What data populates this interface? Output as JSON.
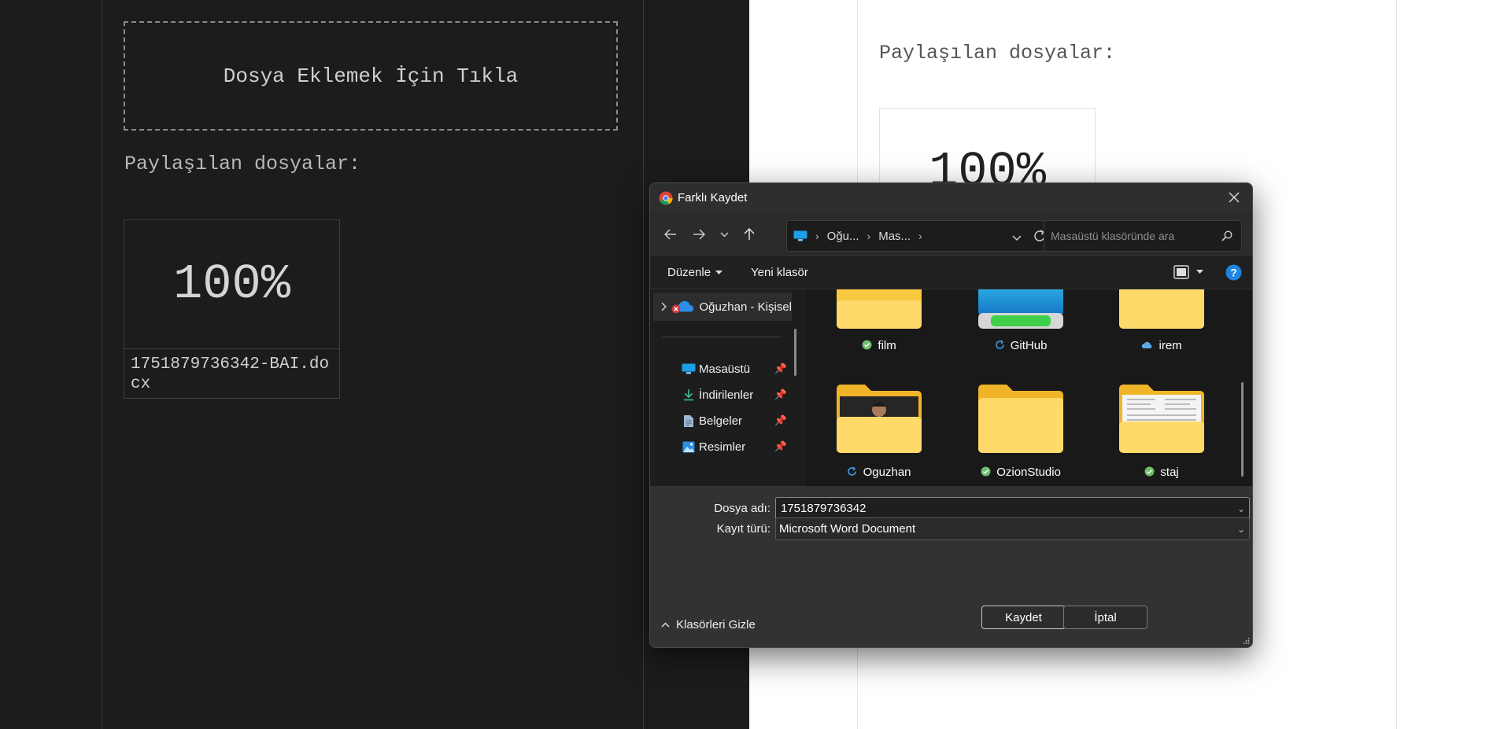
{
  "background_page": {
    "dropzone_text": "Dosya Eklemek İçin Tıkla",
    "shared_label": "Paylaşılan dosyalar:",
    "file_card": {
      "percent": "100%",
      "file_name": "1751879736342-BAI.docx"
    }
  },
  "light_page": {
    "shared_label": "Paylaşılan dosyalar:",
    "file_card": {
      "percent": "100%"
    }
  },
  "dialog": {
    "title": "Farklı Kaydet",
    "breadcrumb": [
      "Oğu...",
      "Mas..."
    ],
    "search_placeholder": "Masaüstü klasöründe ara",
    "toolbar": {
      "organize_label": "Düzenle",
      "new_folder_label": "Yeni klasör"
    },
    "nav_items": [
      {
        "label": "Oğuzhan - Kişisel",
        "icon": "onedrive-icon"
      },
      {
        "label": "Masaüstü",
        "icon": "desktop-icon"
      },
      {
        "label": "İndirilenler",
        "icon": "download-icon"
      },
      {
        "label": "Belgeler",
        "icon": "document-icon"
      },
      {
        "label": "Resimler",
        "icon": "pictures-icon"
      }
    ],
    "folders": [
      {
        "name": "film",
        "status": "synced"
      },
      {
        "name": "GitHub",
        "status": "syncing"
      },
      {
        "name": "irem",
        "status": "cloud"
      },
      {
        "name": "Oguzhan",
        "status": "syncing"
      },
      {
        "name": "OzionStudio",
        "status": "synced"
      },
      {
        "name": "staj",
        "status": "synced"
      }
    ],
    "file_name_label": "Dosya adı:",
    "file_name_value": "1751879736342",
    "file_type_label": "Kayıt türü:",
    "file_type_value": "Microsoft Word Document",
    "hide_folders_label": "Klasörleri Gizle",
    "save_label": "Kaydet",
    "cancel_label": "İptal",
    "colors": {
      "folder": "#f8c93e",
      "accent_blue": "#0a74d8",
      "sync_green": "#6cc06c",
      "error_red": "#d13438"
    }
  }
}
